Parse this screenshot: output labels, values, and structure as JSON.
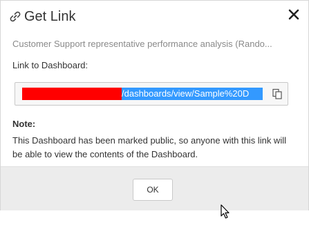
{
  "dialog": {
    "title": "Get Link",
    "title_icon": "link-icon",
    "close_label": "✕",
    "subtitle": "Customer Support representative performance analysis (Rando...",
    "link_label": "Link to Dashboard:",
    "link_value_visible": "/dashboards/view/Sample%20D",
    "link_prefix_redacted": true,
    "copy_icon": "copy-icon",
    "note_heading": "Note:",
    "note_text": "This Dashboard has been marked public, so anyone with this link will be able to view the contents of the Dashboard.",
    "ok_label": "OK"
  },
  "colors": {
    "selection": "#3399ff",
    "redaction": "#ff0000",
    "footer": "#ececec"
  }
}
